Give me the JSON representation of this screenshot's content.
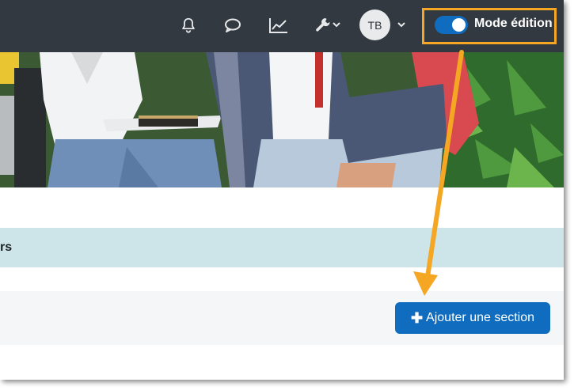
{
  "navbar": {
    "avatar_initials": "TB",
    "icons": [
      "bell-icon",
      "chat-icon",
      "chart-icon",
      "wrench-icon",
      "chevron-down-icon"
    ]
  },
  "edit_mode": {
    "label": "Mode édition",
    "enabled": true,
    "toggle_color": "#0f6cbf",
    "highlight_color": "#f5a623"
  },
  "course": {
    "section_title_partial": "rs"
  },
  "actions": {
    "add_section_label": "Ajouter une section"
  },
  "colors": {
    "navbar_bg": "#333940",
    "section_bar_bg": "#cde5e9",
    "primary": "#0f6cbf",
    "annotation_arrow": "#f5a623"
  }
}
